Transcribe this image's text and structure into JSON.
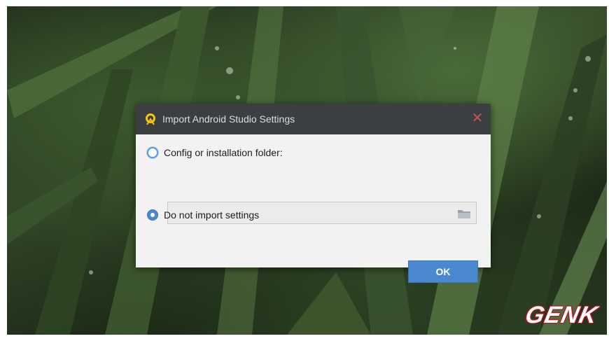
{
  "dialog": {
    "title": "Import Android Studio Settings",
    "close_symbol": "✕",
    "option_config_label": "Config or installation folder:",
    "option_config_selected": false,
    "path_value": "",
    "path_placeholder": "",
    "option_no_import_label": "Do not import settings",
    "option_no_import_selected": true,
    "ok_label": "OK"
  },
  "watermark": {
    "text": "GENK"
  },
  "icons": {
    "app": "android-studio-icon",
    "folder": "folder-icon",
    "close": "close-icon"
  },
  "colors": {
    "accent": "#4a89d0",
    "titlebar": "#3c3f41",
    "close": "#c75450"
  }
}
